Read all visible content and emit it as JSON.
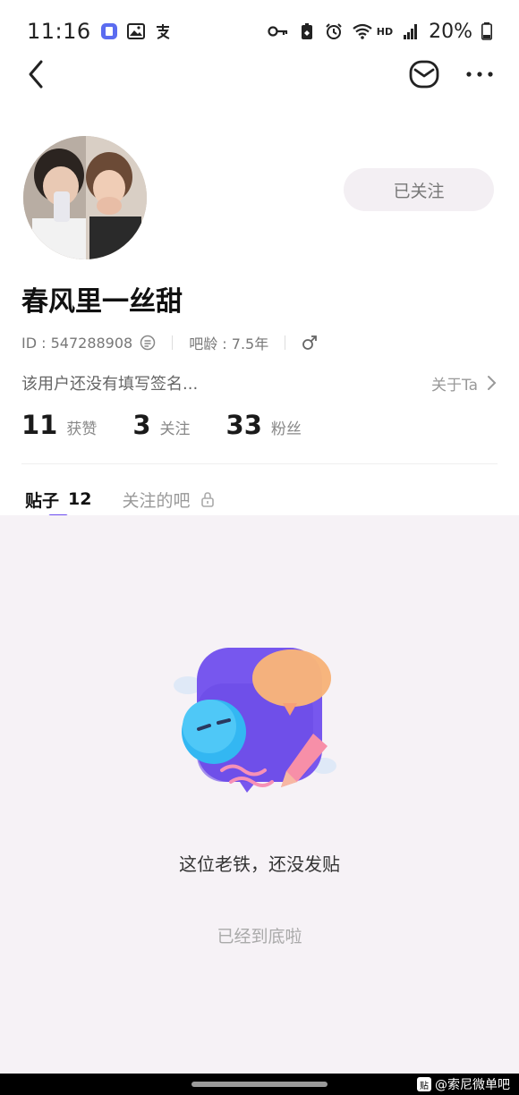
{
  "status_bar": {
    "time": "11:16",
    "battery": "20%",
    "network": "HD"
  },
  "profile": {
    "follow_label": "已关注",
    "username": "春风里一丝甜",
    "id_text": "ID : 547288908",
    "age_text": "吧龄 : 7.5年",
    "bio": "该用户还没有填写签名...",
    "about_label": "关于Ta"
  },
  "stats": [
    {
      "num": "11",
      "label": "获赞"
    },
    {
      "num": "3",
      "label": "关注"
    },
    {
      "num": "33",
      "label": "粉丝"
    }
  ],
  "tabs": {
    "posts_label": "贴子",
    "posts_count": "12",
    "followed_bars_label": "关注的吧"
  },
  "empty": {
    "title": "这位老铁，还没发贴",
    "end": "已经到底啦"
  },
  "watermark": {
    "badge": "贴",
    "text": "@索尼微单吧"
  },
  "colors": {
    "accent": "#6b4cf0",
    "follow_bg": "#f3eff3",
    "content_bg": "#f6f2f6"
  }
}
